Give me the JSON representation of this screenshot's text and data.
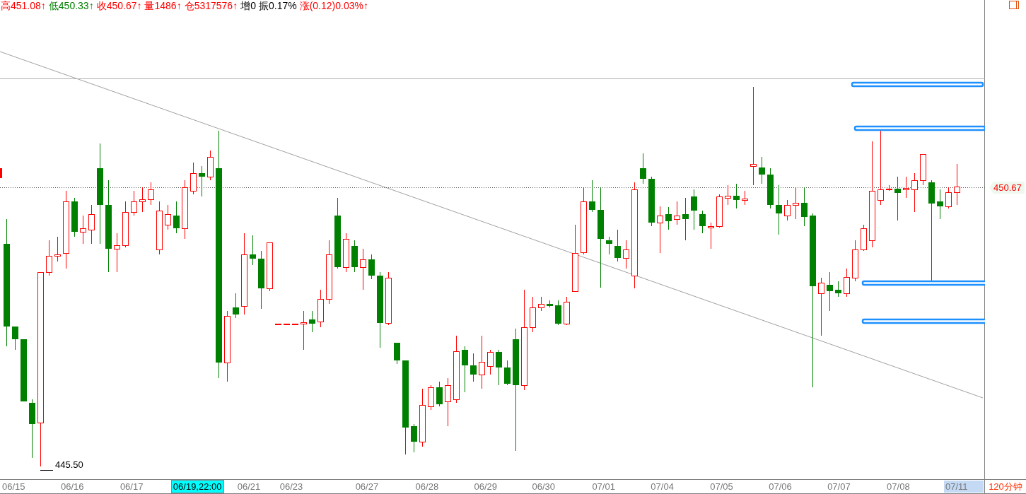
{
  "quote_bar": [
    {
      "text": "高451.08↑",
      "color": "#ff0000"
    },
    {
      "text": "低450.33↑",
      "color": "#008000"
    },
    {
      "text": "收450.67↑",
      "color": "#ff0000"
    },
    {
      "text": "量1486↑",
      "color": "#ff0000"
    },
    {
      "text": "仓5317576↑",
      "color": "#ff0000"
    },
    {
      "text": "增0",
      "color": "#000000"
    },
    {
      "text": "振0.17%",
      "color": "#000000"
    },
    {
      "text": "涨(0.12)0.03%↑",
      "color": "#ff0000"
    }
  ],
  "chart": {
    "last_price": "450.67",
    "low_label": "445.50"
  },
  "time_axis": [
    {
      "label": "06/15",
      "kind": "plain"
    },
    {
      "label": "06/16",
      "kind": "plain"
    },
    {
      "label": "06/17",
      "kind": "plain"
    },
    {
      "label": "06/19,22:00",
      "kind": "cursor"
    },
    {
      "label": "06/21",
      "kind": "plain"
    },
    {
      "label": "06/23",
      "kind": "plain"
    },
    {
      "label": "06/27",
      "kind": "plain"
    },
    {
      "label": "06/28",
      "kind": "plain"
    },
    {
      "label": "06/29",
      "kind": "plain"
    },
    {
      "label": "06/30",
      "kind": "plain"
    },
    {
      "label": "07/01",
      "kind": "plain"
    },
    {
      "label": "07/04",
      "kind": "plain"
    },
    {
      "label": "07/05",
      "kind": "plain"
    },
    {
      "label": "07/06",
      "kind": "plain"
    },
    {
      "label": "07/07",
      "kind": "plain"
    },
    {
      "label": "07/08",
      "kind": "plain"
    },
    {
      "label": "07/11",
      "kind": "current"
    }
  ],
  "period": "120分钟"
}
